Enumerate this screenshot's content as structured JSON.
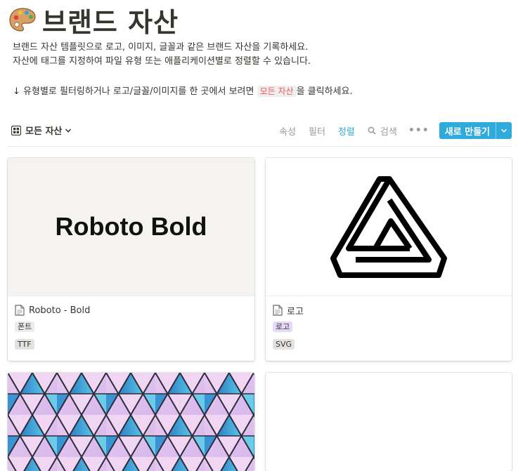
{
  "page": {
    "icon": "artist-palette-icon",
    "title": "브랜드 자산",
    "desc_line1": "브랜드 자산 템플릿으로 로고, 이미지, 글꼴과 같은 브랜드 자산을 기록하세요.",
    "desc_line2": "자산에 태그를 지정하여 파일 유형 또는 애플리케이션별로 정렬할 수 있습니다.",
    "desc_line3_prefix": "↓ 유형별로 필터링하거나 로고/글꼴/이미지를 한 곳에서 보려면",
    "desc_line3_code": "모든 자산",
    "desc_line3_suffix": "을 클릭하세요."
  },
  "toolbar": {
    "view_label": "모든 자산",
    "properties": "속성",
    "filter": "필터",
    "sort": "정렬",
    "search": "검색",
    "more": "•••",
    "new_label": "새로 만들기"
  },
  "colors": {
    "accent": "#2eaadc",
    "tag_font_bg": "#ebeced",
    "tag_logo_bg": "#e5dbf9",
    "tag_ext_bg": "#e3e2e0",
    "cover_gray": "#f4f3ef"
  },
  "cards": [
    {
      "cover_text": "Roboto Bold",
      "name": "Roboto - Bold",
      "tag": "폰트",
      "ext": "TTF"
    },
    {
      "name": "로고",
      "tag": "로고",
      "ext": "SVG"
    },
    {
      "cover": "pink-blue-triangle-pattern"
    },
    {
      "cover": "blank"
    }
  ]
}
